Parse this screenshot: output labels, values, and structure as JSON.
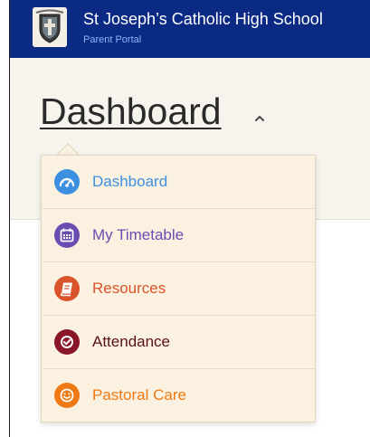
{
  "header": {
    "school_name": "St Joseph’s Catholic High School",
    "portal_name": "Parent Portal",
    "crest_icon": "school-crest-icon"
  },
  "page": {
    "title": "Dashboard"
  },
  "colors": {
    "header_bg": "#0b2a84",
    "dashboard": "#3d8fe0",
    "timetable": "#6b4cb0",
    "resources": "#d9532b",
    "attendance": "#8a1728",
    "pastoral": "#ef7a14"
  },
  "menu": {
    "items": [
      {
        "label": "Dashboard",
        "icon": "speedometer-icon",
        "color": "#3d8fe0"
      },
      {
        "label": "My Timetable",
        "icon": "calendar-icon",
        "color": "#6b4cb0"
      },
      {
        "label": "Resources",
        "icon": "book-icon",
        "color": "#d9532b"
      },
      {
        "label": "Attendance",
        "icon": "check-circle-icon",
        "color": "#8a1728"
      },
      {
        "label": "Pastoral Care",
        "icon": "smiley-icon",
        "color": "#ef7a14"
      }
    ]
  }
}
